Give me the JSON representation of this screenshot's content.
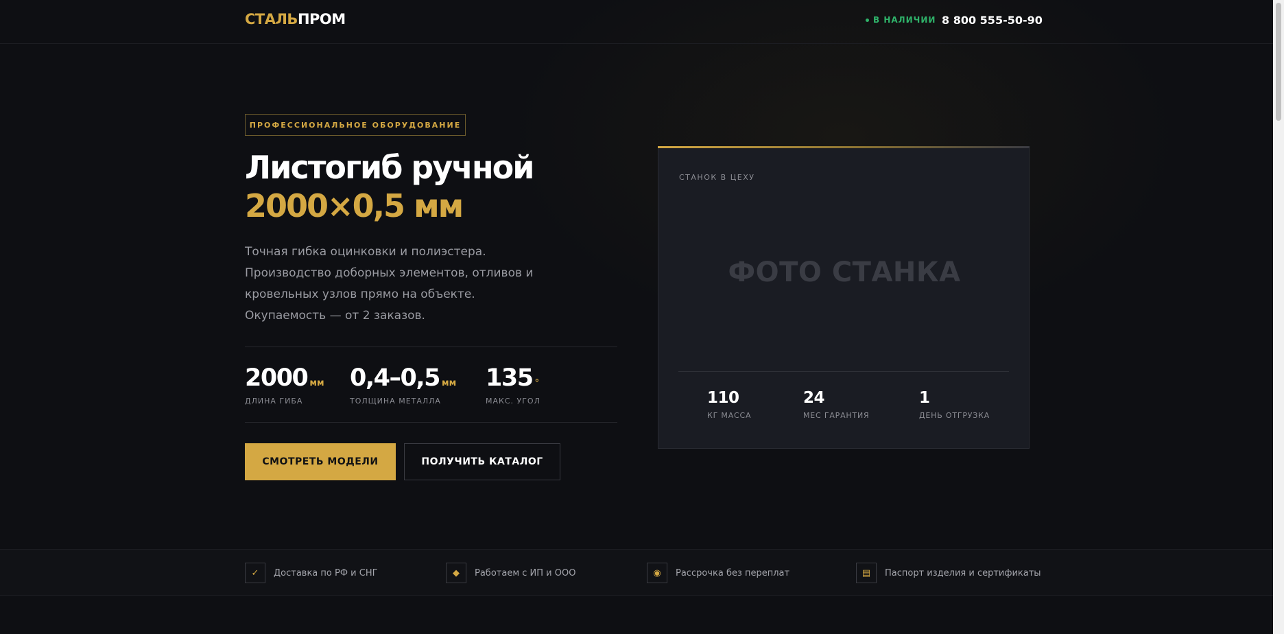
{
  "header": {
    "logo_part1": "СТАЛЬ",
    "logo_part2": "ПРОМ",
    "stock_status": "В НАЛИЧИИ",
    "phone": "8 800 555-50-90"
  },
  "hero": {
    "badge": "ПРОФЕССИОНАЛЬНОЕ ОБОРУДОВАНИЕ",
    "title_line1": "Листогиб ручной",
    "title_line2": "2000×0,5 мм",
    "description": "Точная гибка оцинковки и полиэстера. Производство доборных элементов, отливов и кровельных узлов прямо на объекте. Окупаемость — от 2 заказов.",
    "stats": [
      {
        "value": "2000",
        "unit": "мм",
        "label": "ДЛИНА ГИБА"
      },
      {
        "value": "0,4–0,5",
        "unit": "мм",
        "label": "ТОЛЩИНА МЕТАЛЛА"
      },
      {
        "value": "135",
        "unit": "°",
        "label": "МАКС. УГОЛ"
      }
    ],
    "btn_primary": "СМОТРЕТЬ МОДЕЛИ",
    "btn_secondary": "ПОЛУЧИТЬ КАТАЛОГ"
  },
  "card": {
    "caption": "СТАНОК В ЦЕХУ",
    "photo_placeholder": "ФОТО СТАНКА",
    "stats": [
      {
        "value": "110",
        "label": "КГ МАССА"
      },
      {
        "value": "24",
        "label": "МЕС ГАРАНТИЯ"
      },
      {
        "value": "1",
        "label": "ДЕНЬ ОТГРУЗКА"
      }
    ]
  },
  "features": [
    {
      "icon": "check-icon",
      "glyph": "✓",
      "text": "Доставка по РФ и СНГ"
    },
    {
      "icon": "diamond-icon",
      "glyph": "◆",
      "text": "Работаем с ИП и ООО"
    },
    {
      "icon": "coin-icon",
      "glyph": "◉",
      "text": "Рассрочка без переплат"
    },
    {
      "icon": "document-icon",
      "glyph": "▤",
      "text": "Паспорт изделия и сертификаты"
    }
  ],
  "colors": {
    "accent": "#d4a843",
    "background": "#0e0f13",
    "card": "#1a1c23",
    "status_green": "#2fb36a"
  }
}
